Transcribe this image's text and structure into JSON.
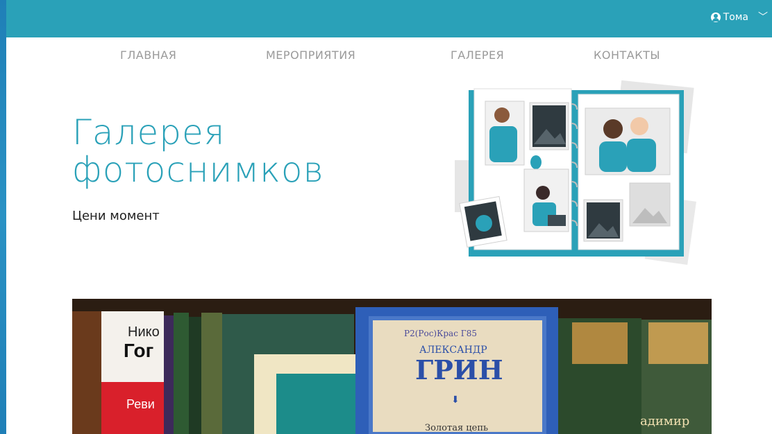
{
  "user": {
    "name": "Тома"
  },
  "nav": {
    "items": [
      {
        "label": "ГЛАВНАЯ"
      },
      {
        "label": "МЕРОПРИЯТИЯ"
      },
      {
        "label": "ГАЛЕРЕЯ"
      },
      {
        "label": "КОНТАКТЫ"
      }
    ]
  },
  "hero": {
    "title_line1": "Галерея",
    "title_line2": "фотоснимков",
    "subtitle": "Цени момент"
  },
  "photo": {
    "book_author_top": "Нико",
    "book_title_top": "Гог",
    "book_red_text": "Реви",
    "center_author": "АЛЕКСАНДР",
    "center_title": "ГРИН",
    "center_subtitle": "Золотая цепь",
    "handwritten": "Р2(Рос)Крас Г85",
    "right_book_text": "адимир"
  },
  "colors": {
    "accent": "#2aa1b8",
    "nav_text": "#9a9a9a",
    "background_frame": "#1f7fb7"
  }
}
